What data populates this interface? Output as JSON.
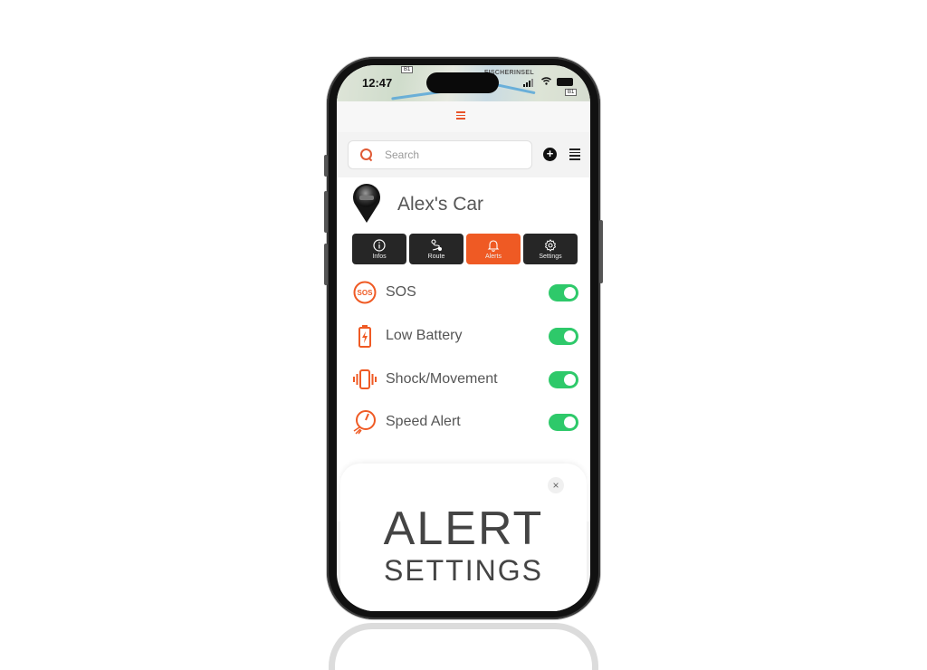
{
  "statusbar": {
    "time": "12:47",
    "map_label": "FISCHERINSEL",
    "road_badge": "B1"
  },
  "search": {
    "placeholder": "Search"
  },
  "vehicle": {
    "name": "Alex's Car"
  },
  "tabs": [
    {
      "label": "Infos",
      "icon": "info-icon",
      "active": false
    },
    {
      "label": "Route",
      "icon": "route-icon",
      "active": false
    },
    {
      "label": "Alerts",
      "icon": "bell-icon",
      "active": true
    },
    {
      "label": "Settings",
      "icon": "gear-icon",
      "active": false
    }
  ],
  "alerts": [
    {
      "label": "SOS",
      "icon": "sos-icon",
      "enabled": true
    },
    {
      "label": "Low Battery",
      "icon": "battery-icon",
      "enabled": true
    },
    {
      "label": "Shock/Movement",
      "icon": "vibration-icon",
      "enabled": true
    },
    {
      "label": "Speed Alert",
      "icon": "speedometer-icon",
      "enabled": true
    }
  ],
  "sheet": {
    "title_line1": "ALERT",
    "title_line2": "SETTINGS",
    "close_symbol": "×"
  },
  "colors": {
    "accent": "#ef5a24",
    "toggle_on": "#2ec96a",
    "tab_bg": "#262626"
  }
}
